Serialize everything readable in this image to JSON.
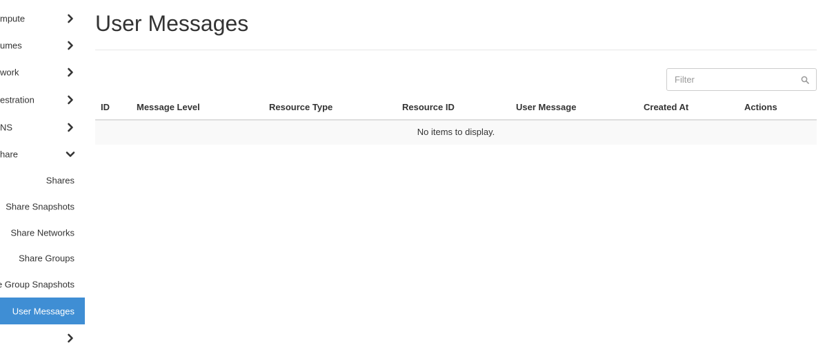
{
  "sidebar": {
    "sections": [
      {
        "label": "mpute",
        "icon": "chevron-right-icon"
      },
      {
        "label": "umes",
        "icon": "chevron-right-icon"
      },
      {
        "label": "work",
        "icon": "chevron-right-icon"
      },
      {
        "label": "estration",
        "icon": "chevron-right-icon"
      },
      {
        "label": "NS",
        "icon": "chevron-right-icon"
      },
      {
        "label": "hare",
        "icon": "chevron-down-icon"
      }
    ],
    "share_items": [
      {
        "label": "Shares"
      },
      {
        "label": "Share Snapshots"
      },
      {
        "label": "Share Networks"
      },
      {
        "label": "Share Groups"
      },
      {
        "label": "e Group Snapshots"
      },
      {
        "label": "User Messages",
        "active": true
      }
    ],
    "bottom_section": {
      "label": "",
      "icon": "chevron-right-icon"
    }
  },
  "main": {
    "title": "User Messages",
    "filter": {
      "placeholder": "Filter",
      "value": ""
    },
    "table": {
      "columns": [
        "ID",
        "Message Level",
        "Resource Type",
        "Resource ID",
        "User Message",
        "Created At",
        "Actions"
      ],
      "rows": [],
      "empty_text": "No items to display."
    }
  },
  "colors": {
    "active_bg": "#3f8ed4",
    "empty_row_bg": "#f9f9f9"
  }
}
